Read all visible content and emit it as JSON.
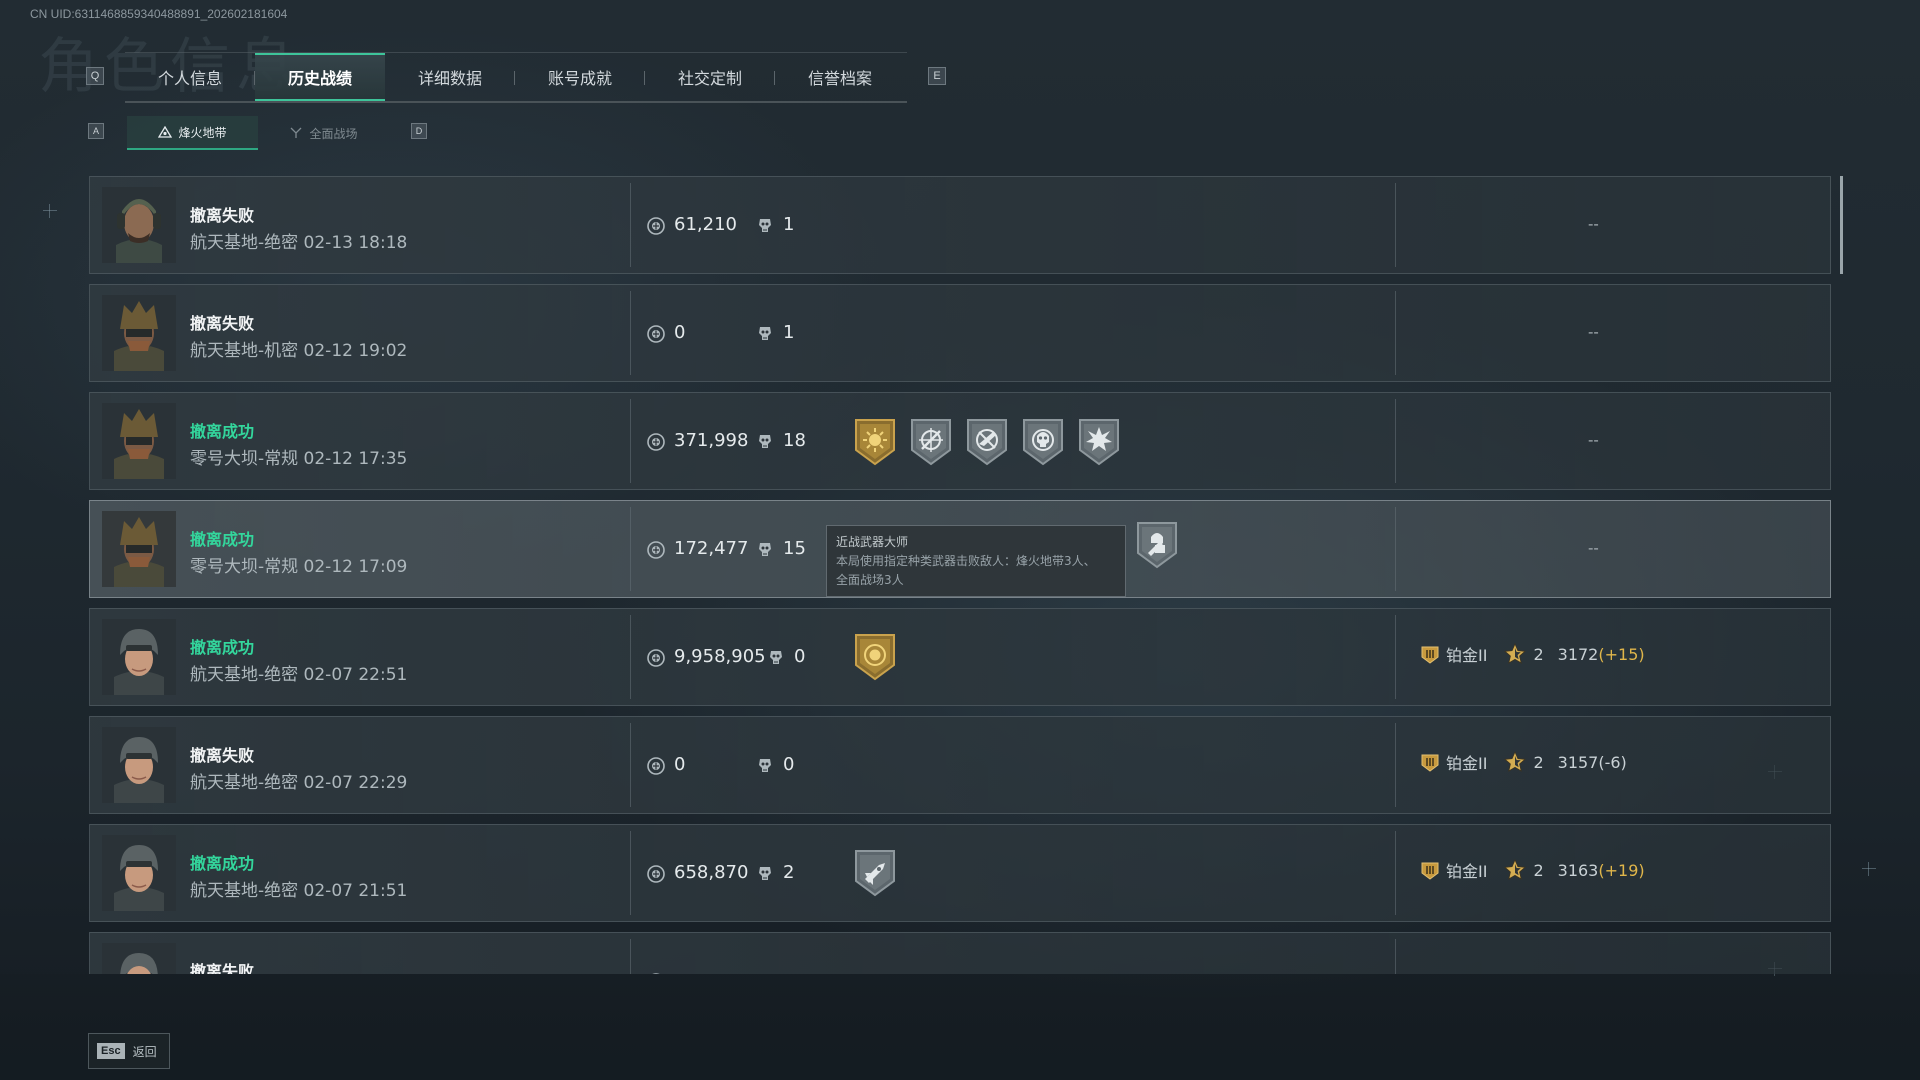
{
  "header": {
    "uid": "CN UID:6311468859340488891_202602181604",
    "ghost_title": "角色信息"
  },
  "main_tabs": {
    "left_key": "Q",
    "right_key": "E",
    "items": [
      {
        "label": "个人信息"
      },
      {
        "label": "历史战绩",
        "active": true
      },
      {
        "label": "详细数据"
      },
      {
        "label": "账号成就"
      },
      {
        "label": "社交定制"
      },
      {
        "label": "信誉档案"
      }
    ]
  },
  "sub_tabs": {
    "left_key": "A",
    "right_key": "D",
    "items": [
      {
        "label": "烽火地带",
        "active": true
      },
      {
        "label": "全面战场"
      }
    ]
  },
  "records": [
    {
      "status": "撤离失败",
      "success": false,
      "map": "航天基地-绝密",
      "time": "02-13 18:18",
      "value": "61,210",
      "kills": "1",
      "badges": [],
      "rank": null,
      "rank_placeholder": "--",
      "avatar": "operator-a"
    },
    {
      "status": "撤离失败",
      "success": false,
      "map": "航天基地-机密",
      "time": "02-12 19:02",
      "value": "0",
      "kills": "1",
      "badges": [],
      "rank": null,
      "rank_placeholder": "--",
      "avatar": "operator-b"
    },
    {
      "status": "撤离成功",
      "success": true,
      "map": "零号大坝-常规",
      "time": "02-12 17:35",
      "value": "371,998",
      "kills": "18",
      "badges": [
        "gold-sun-badge",
        "crosshair-badge",
        "no-gun-badge",
        "skull-badge",
        "explosion-badge"
      ],
      "rank": null,
      "rank_placeholder": "--",
      "avatar": "operator-b"
    },
    {
      "status": "撤离成功",
      "success": true,
      "map": "零号大坝-常规",
      "time": "02-12 17:09",
      "value": "172,477",
      "kills": "15",
      "badges": [
        "melee-master-badge"
      ],
      "rank": null,
      "rank_placeholder": "--",
      "avatar": "operator-b",
      "tooltip": {
        "title": "近战武器大师",
        "line1": "本局使用指定种类武器击败敌人：烽火地带3人、",
        "line2": "全面战场3人"
      }
    },
    {
      "status": "撤离成功",
      "success": true,
      "map": "航天基地-绝密",
      "time": "02-07 22:51",
      "value": "9,958,905",
      "kills": "0",
      "badges": [
        "gold-coin-badge"
      ],
      "rank": {
        "name": "铂金II",
        "stars": "2",
        "score": "3172",
        "delta": "(+15)"
      },
      "avatar": "operator-c"
    },
    {
      "status": "撤离失败",
      "success": false,
      "map": "航天基地-绝密",
      "time": "02-07 22:29",
      "value": "0",
      "kills": "0",
      "badges": [],
      "rank": {
        "name": "铂金II",
        "stars": "2",
        "score": "3157",
        "delta": "(-6)"
      },
      "avatar": "operator-c"
    },
    {
      "status": "撤离成功",
      "success": true,
      "map": "航天基地-绝密",
      "time": "02-07 21:51",
      "value": "658,870",
      "kills": "2",
      "badges": [
        "rocket-badge"
      ],
      "rank": {
        "name": "铂金II",
        "stars": "2",
        "score": "3163",
        "delta": "(+19)"
      },
      "avatar": "operator-c"
    },
    {
      "status": "撤离失败",
      "success": false,
      "map": "",
      "time": "",
      "value": "",
      "kills": "",
      "badges": [],
      "rank": null,
      "rank_placeholder": "",
      "avatar": "operator-c"
    }
  ],
  "footer": {
    "esc_key": "Esc",
    "back_label": "返回"
  },
  "colors": {
    "success": "#33d69c",
    "accent": "#3ec49a",
    "gold": "#e0b64a"
  }
}
